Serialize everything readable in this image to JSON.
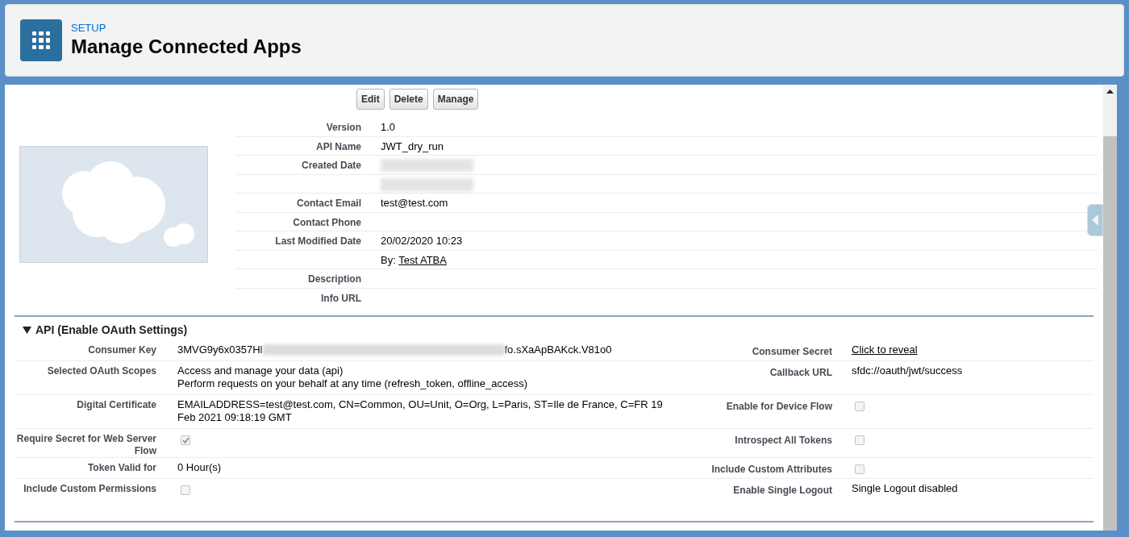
{
  "header": {
    "eyebrow": "SETUP",
    "title": "Manage Connected Apps"
  },
  "buttons": [
    "Edit",
    "Delete",
    "Manage"
  ],
  "details": [
    {
      "label": "Version",
      "kind": "text",
      "value": "1.0"
    },
    {
      "label": "API Name",
      "kind": "text",
      "value": "JWT_dry_run"
    },
    {
      "label": "Created Date",
      "kind": "redacted"
    },
    {
      "kind": "redacted"
    },
    {
      "label": "Contact Email",
      "kind": "text",
      "value": "test@test.com"
    },
    {
      "label": "Contact Phone",
      "kind": "text"
    },
    {
      "label": "Last Modified Date",
      "kind": "text",
      "value": "20/02/2020 10:23"
    },
    {
      "kind": "by",
      "prefix": "By:",
      "link": "Test ATBA"
    },
    {
      "label": "Description",
      "kind": "text"
    },
    {
      "label": "Info URL",
      "kind": "text"
    }
  ],
  "api_section": {
    "title": "API (Enable OAuth Settings)",
    "expanded": true,
    "rows": [
      [
        {
          "label": "Consumer Key",
          "kind": "partial",
          "start": "3MVG9y6x0357Hl",
          "end": "fo.sXaApBAKck.V81o0"
        },
        {
          "label": "Consumer Secret",
          "kind": "link",
          "value": "Click to reveal"
        }
      ],
      [
        {
          "label": "Selected OAuth Scopes",
          "kind": "lines",
          "lines": [
            "Access and manage your data (api)",
            "Perform requests on your behalf at any time (refresh_token, offline_access)"
          ]
        },
        {
          "label": "Callback URL",
          "kind": "text",
          "value": "sfdc://oauth/jwt/success"
        }
      ],
      [
        {
          "label": "Digital Certificate",
          "kind": "text",
          "value": "EMAILADDRESS=test@test.com, CN=Common, OU=Unit, O=Org, L=Paris, ST=Ile de France, C=FR 19 Feb 2021 09:18:19 GMT"
        },
        {
          "label": "Enable for Device Flow",
          "kind": "checkbox",
          "checked": false
        }
      ],
      [
        {
          "label": "Require Secret for Web Server Flow",
          "kind": "checkbox",
          "checked": true
        },
        {
          "label": "Introspect All Tokens",
          "kind": "checkbox",
          "checked": false
        }
      ],
      [
        {
          "label": "Token Valid for",
          "kind": "text",
          "value": "0 Hour(s)"
        },
        {
          "label": "Include Custom Attributes",
          "kind": "checkbox",
          "checked": false
        }
      ],
      [
        {
          "label": "Include Custom Permissions",
          "kind": "checkbox",
          "checked": false
        },
        {
          "label": "Enable Single Logout",
          "kind": "text",
          "value": "Single Logout disabled"
        }
      ]
    ]
  }
}
